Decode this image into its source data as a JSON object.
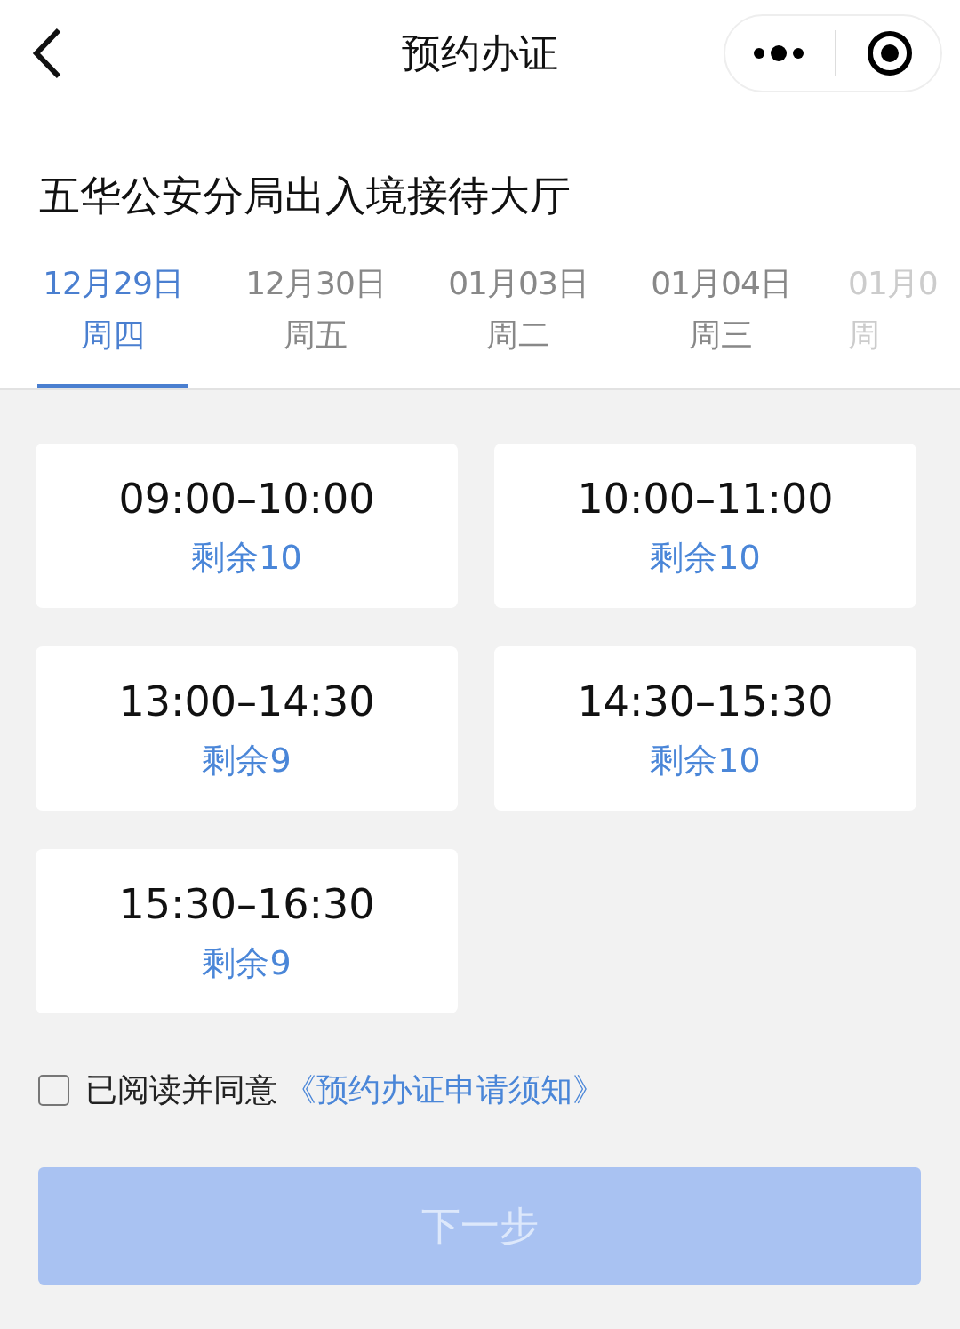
{
  "nav": {
    "title": "预约办证"
  },
  "office": "五华公安分局出入境接待大厅",
  "date_tabs": [
    {
      "date": "12月29日",
      "weekday": "周四",
      "selected": true,
      "cut": false
    },
    {
      "date": "12月30日",
      "weekday": "周五",
      "selected": false,
      "cut": false
    },
    {
      "date": "01月03日",
      "weekday": "周二",
      "selected": false,
      "cut": false
    },
    {
      "date": "01月04日",
      "weekday": "周三",
      "selected": false,
      "cut": false
    },
    {
      "date": "01月0",
      "weekday": "周",
      "selected": false,
      "cut": true
    }
  ],
  "slots": [
    {
      "time": "09:00–10:00",
      "remaining": "剩余10"
    },
    {
      "time": "10:00–11:00",
      "remaining": "剩余10"
    },
    {
      "time": "13:00–14:30",
      "remaining": "剩余9"
    },
    {
      "time": "14:30–15:30",
      "remaining": "剩余10"
    },
    {
      "time": "15:30–16:30",
      "remaining": "剩余9"
    }
  ],
  "agreement": {
    "checked": false,
    "text": "已阅读并同意",
    "link": "《预约办证申请须知》"
  },
  "next_button": {
    "label": "下一步",
    "disabled": true
  }
}
